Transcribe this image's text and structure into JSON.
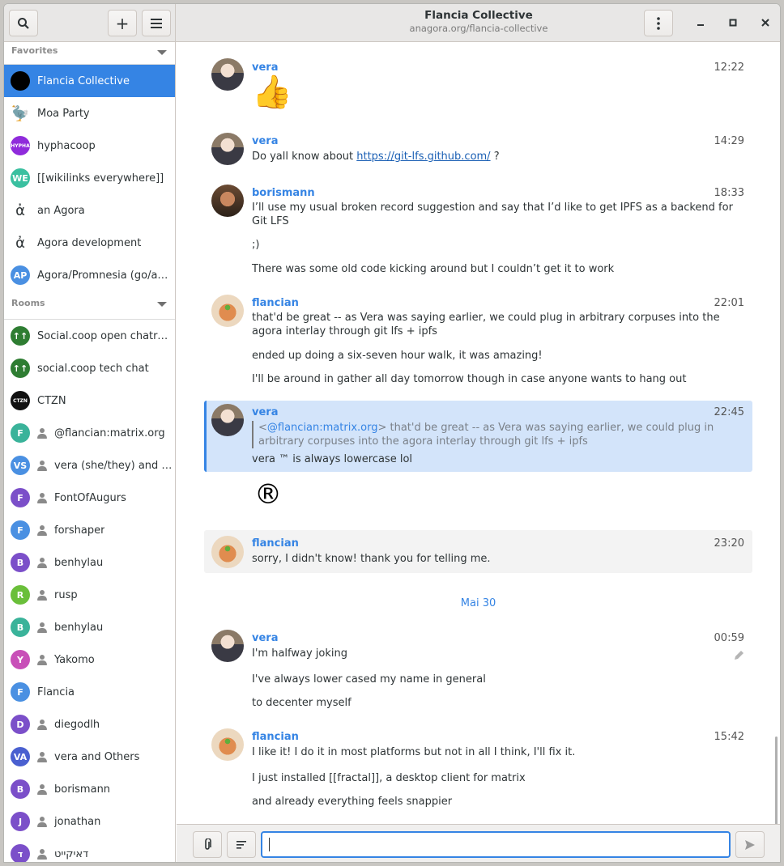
{
  "header": {
    "title": "Flancia Collective",
    "subtitle": "anagora.org/flancia-collective"
  },
  "sidebar": {
    "favorites_label": "Favorites",
    "rooms_label": "Rooms",
    "favorites": [
      {
        "name": "Flancia Collective",
        "initials": "",
        "color": "#000000",
        "active": true
      },
      {
        "name": "Moa Party",
        "initials": "🦤",
        "color": "#ffffff"
      },
      {
        "name": "hyphacoop",
        "initials": "HYPHA",
        "color": "#8f2bdb"
      },
      {
        "name": "[[wikilinks everywhere]]",
        "initials": "WE",
        "color": "#3ac0a0"
      },
      {
        "name": "an Agora",
        "initials": "ἀ",
        "color": "#ffffff"
      },
      {
        "name": "Agora development",
        "initials": "ἀ",
        "color": "#ffffff"
      },
      {
        "name": "Agora/Promnesia (go/a…",
        "initials": "AP",
        "color": "#4a90e2"
      }
    ],
    "rooms": [
      {
        "name": "Social.coop open chatro…",
        "initials": "↑↑",
        "color": "#2e7d32"
      },
      {
        "name": "social.coop tech chat",
        "initials": "↑↑",
        "color": "#2e7d32"
      },
      {
        "name": "CTZN",
        "initials": "CTZN",
        "color": "#111111"
      },
      {
        "name": "@flancian:matrix.org",
        "initials": "F",
        "color": "#3ab39a",
        "dm": true
      },
      {
        "name": "vera (she/they) and …",
        "initials": "VS",
        "color": "#4a90e2",
        "dm": true
      },
      {
        "name": "FontOfAugurs",
        "initials": "F",
        "color": "#7b4fc9",
        "dm": true
      },
      {
        "name": "forshaper",
        "initials": "F",
        "color": "#4a90e2",
        "dm": true
      },
      {
        "name": "benhylau",
        "initials": "B",
        "color": "#7b4fc9",
        "dm": true
      },
      {
        "name": "rusp",
        "initials": "R",
        "color": "#6abf3a",
        "dm": true
      },
      {
        "name": "benhylau",
        "initials": "B",
        "color": "#3ab39a",
        "dm": true
      },
      {
        "name": "Yakomo",
        "initials": "Y",
        "color": "#c84fb8",
        "dm": true
      },
      {
        "name": "Flancia",
        "initials": "F",
        "color": "#4a90e2"
      },
      {
        "name": "diegodlh",
        "initials": "D",
        "color": "#7b4fc9",
        "dm": true
      },
      {
        "name": "vera and Others",
        "initials": "VA",
        "color": "#4a60d0",
        "dm": true
      },
      {
        "name": "borismann",
        "initials": "B",
        "color": "#7b4fc9",
        "dm": true
      },
      {
        "name": "jonathan",
        "initials": "J",
        "color": "#7b4fc9",
        "dm": true
      },
      {
        "name": "דאיקייט",
        "initials": "ד",
        "color": "#7b4fc9",
        "dm": true
      }
    ]
  },
  "messages": {
    "m1": {
      "sender": "vera",
      "time": "12:22",
      "emoji": "👍"
    },
    "m2": {
      "sender": "vera",
      "time": "14:29",
      "text_before": "Do yall know about ",
      "link": "https://git-lfs.github.com/",
      "text_after": " ?"
    },
    "m3": {
      "sender": "borismann",
      "time": "18:33",
      "line1": "I’ll use my usual broken record suggestion and say that I’d like to get IPFS as a backend for Git LFS",
      "line2": ";)",
      "line3": "There was some old code kicking around but I couldn’t get it to work"
    },
    "m4": {
      "sender": "flancian",
      "time": "22:01",
      "line1": "that'd be great -- as Vera was saying earlier, we could plug in arbitrary corpuses into the agora interlay through git lfs + ipfs",
      "line2": "ended up doing a six-seven hour walk, it was amazing!",
      "line3": "I'll be around in gather all day tomorrow though in case anyone wants to hang out"
    },
    "m5": {
      "sender": "vera",
      "time": "22:45",
      "quote_prefix": "<",
      "quote_mention": "@flancian:matrix.org",
      "quote_text": "> that'd be great -- as Vera was saying earlier, we could plug in arbitrary corpuses into the agora interlay through git lfs + ipfs",
      "line1": "vera ™ is always lowercase lol",
      "line2": "®"
    },
    "m6": {
      "sender": "flancian",
      "time": "23:20",
      "line1": "sorry, I didn't know! thank you for telling me."
    },
    "day_separator": "Mai 30",
    "m7": {
      "sender": "vera",
      "time": "00:59",
      "line1": "I'm halfway joking",
      "line2": "I've always lower cased my name in general",
      "line3": "to decenter myself"
    },
    "m8": {
      "sender": "flancian",
      "time": "15:42",
      "line1": "I like it! I do it in most platforms but not in all I think, I'll fix it.",
      "line2": "I just installed [[fractal]], a desktop client for matrix",
      "line3": "and already everything feels snappier"
    }
  },
  "composer": {
    "value": ""
  }
}
